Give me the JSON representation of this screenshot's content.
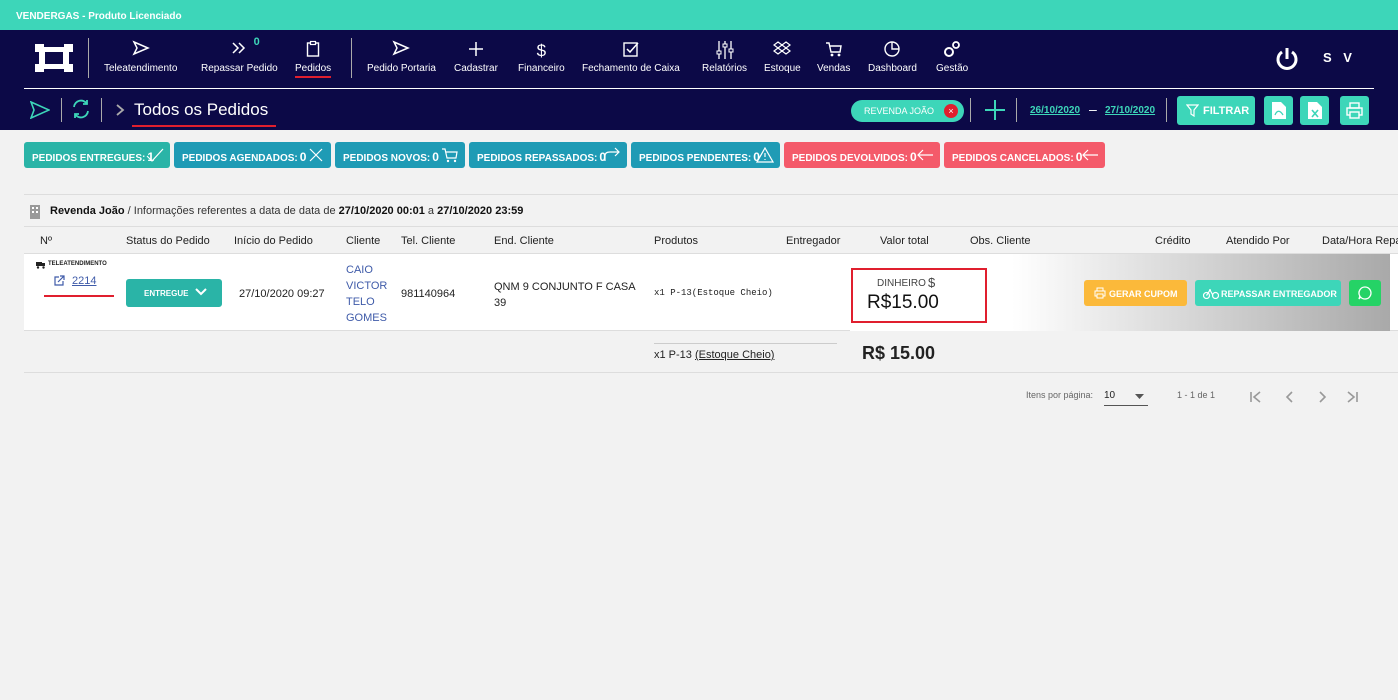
{
  "app": {
    "title": "VENDERGAS - Produto Licenciado"
  },
  "nav": {
    "items": [
      {
        "label": "Teleatendimento",
        "icon": "send-icon"
      },
      {
        "label": "Repassar Pedido",
        "icon": "double-chevron-icon",
        "badge": "0"
      },
      {
        "label": "Pedidos",
        "icon": "clipboard-icon",
        "active": true
      },
      {
        "label": "Pedido Portaria",
        "icon": "send-outline-icon"
      },
      {
        "label": "Cadastrar",
        "icon": "plus-icon"
      },
      {
        "label": "Financeiro",
        "icon": "dollar-icon"
      },
      {
        "label": "Fechamento de Caixa",
        "icon": "check-square-icon"
      },
      {
        "label": "Relatórios",
        "icon": "sliders-icon"
      },
      {
        "label": "Estoque",
        "icon": "dropbox-icon"
      },
      {
        "label": "Vendas",
        "icon": "cart-icon"
      },
      {
        "label": "Dashboard",
        "icon": "pie-chart-icon"
      },
      {
        "label": "Gestão",
        "icon": "gears-icon"
      }
    ],
    "user_initials": "S V"
  },
  "subheader": {
    "title": "Todos os Pedidos",
    "filter_chip": "REVENDA JOÃO",
    "chip_close": "×",
    "date_from": "26/10/2020",
    "date_sep": "–",
    "date_to": "27/10/2020",
    "filter_label": "FILTRAR"
  },
  "summary": [
    {
      "label": "PEDIDOS ENTREGUES:",
      "count": "1",
      "color": "teal"
    },
    {
      "label": "PEDIDOS AGENDADOS:",
      "count": "0",
      "color": "blue"
    },
    {
      "label": "PEDIDOS NOVOS:",
      "count": "0",
      "color": "blue"
    },
    {
      "label": "PEDIDOS REPASSADOS:",
      "count": "0",
      "color": "blue"
    },
    {
      "label": "PEDIDOS PENDENTES:",
      "count": "0",
      "color": "blue"
    },
    {
      "label": "PEDIDOS DEVOLVIDOS:",
      "count": "0",
      "color": "red"
    },
    {
      "label": "PEDIDOS CANCELADOS:",
      "count": "0",
      "color": "red"
    }
  ],
  "info": {
    "store": "Revenda João",
    "text": " / Informações referentes a data de data de ",
    "from": "27/10/2020 00:01",
    "mid": " a ",
    "to": "27/10/2020 23:59"
  },
  "table": {
    "headers": [
      "Nº",
      "Status do Pedido",
      "Início do Pedido",
      "Cliente",
      "Tel. Cliente",
      "End. Cliente",
      "Produtos",
      "Entregador",
      "Valor total",
      "Obs. Cliente",
      "Crédito",
      "Atendido Por",
      "Data/Hora Repas"
    ],
    "row": {
      "source": "TELEATENDIMENTO",
      "number": "2214",
      "status": "ENTREGUE",
      "start": "27/10/2020 09:27",
      "client_lines": [
        "CAIO",
        "VICTOR",
        "TELO",
        "GOMES"
      ],
      "phone": "981140964",
      "address": "QNM 9 CONJUNTO F CASA 39",
      "products": "x1 P-13(Estoque Cheio)",
      "payment_type": "DINHEIRO",
      "payment_symbol": "$",
      "value": "R$15.00",
      "btn_coupon": "GERAR CUPOM",
      "btn_forward": "REPASSAR ENTREGADOR"
    },
    "total": {
      "products_prefix": "x1 P-13",
      "products_stock": "(Estoque Cheio)",
      "value": "R$ 15.00"
    }
  },
  "paginator": {
    "items_label": "Itens por página:",
    "page_size": "10",
    "range": "1 - 1 de 1"
  },
  "colors": {
    "primary": "#0c0947",
    "accent": "#3dd6b9",
    "danger": "#e01f2e"
  }
}
